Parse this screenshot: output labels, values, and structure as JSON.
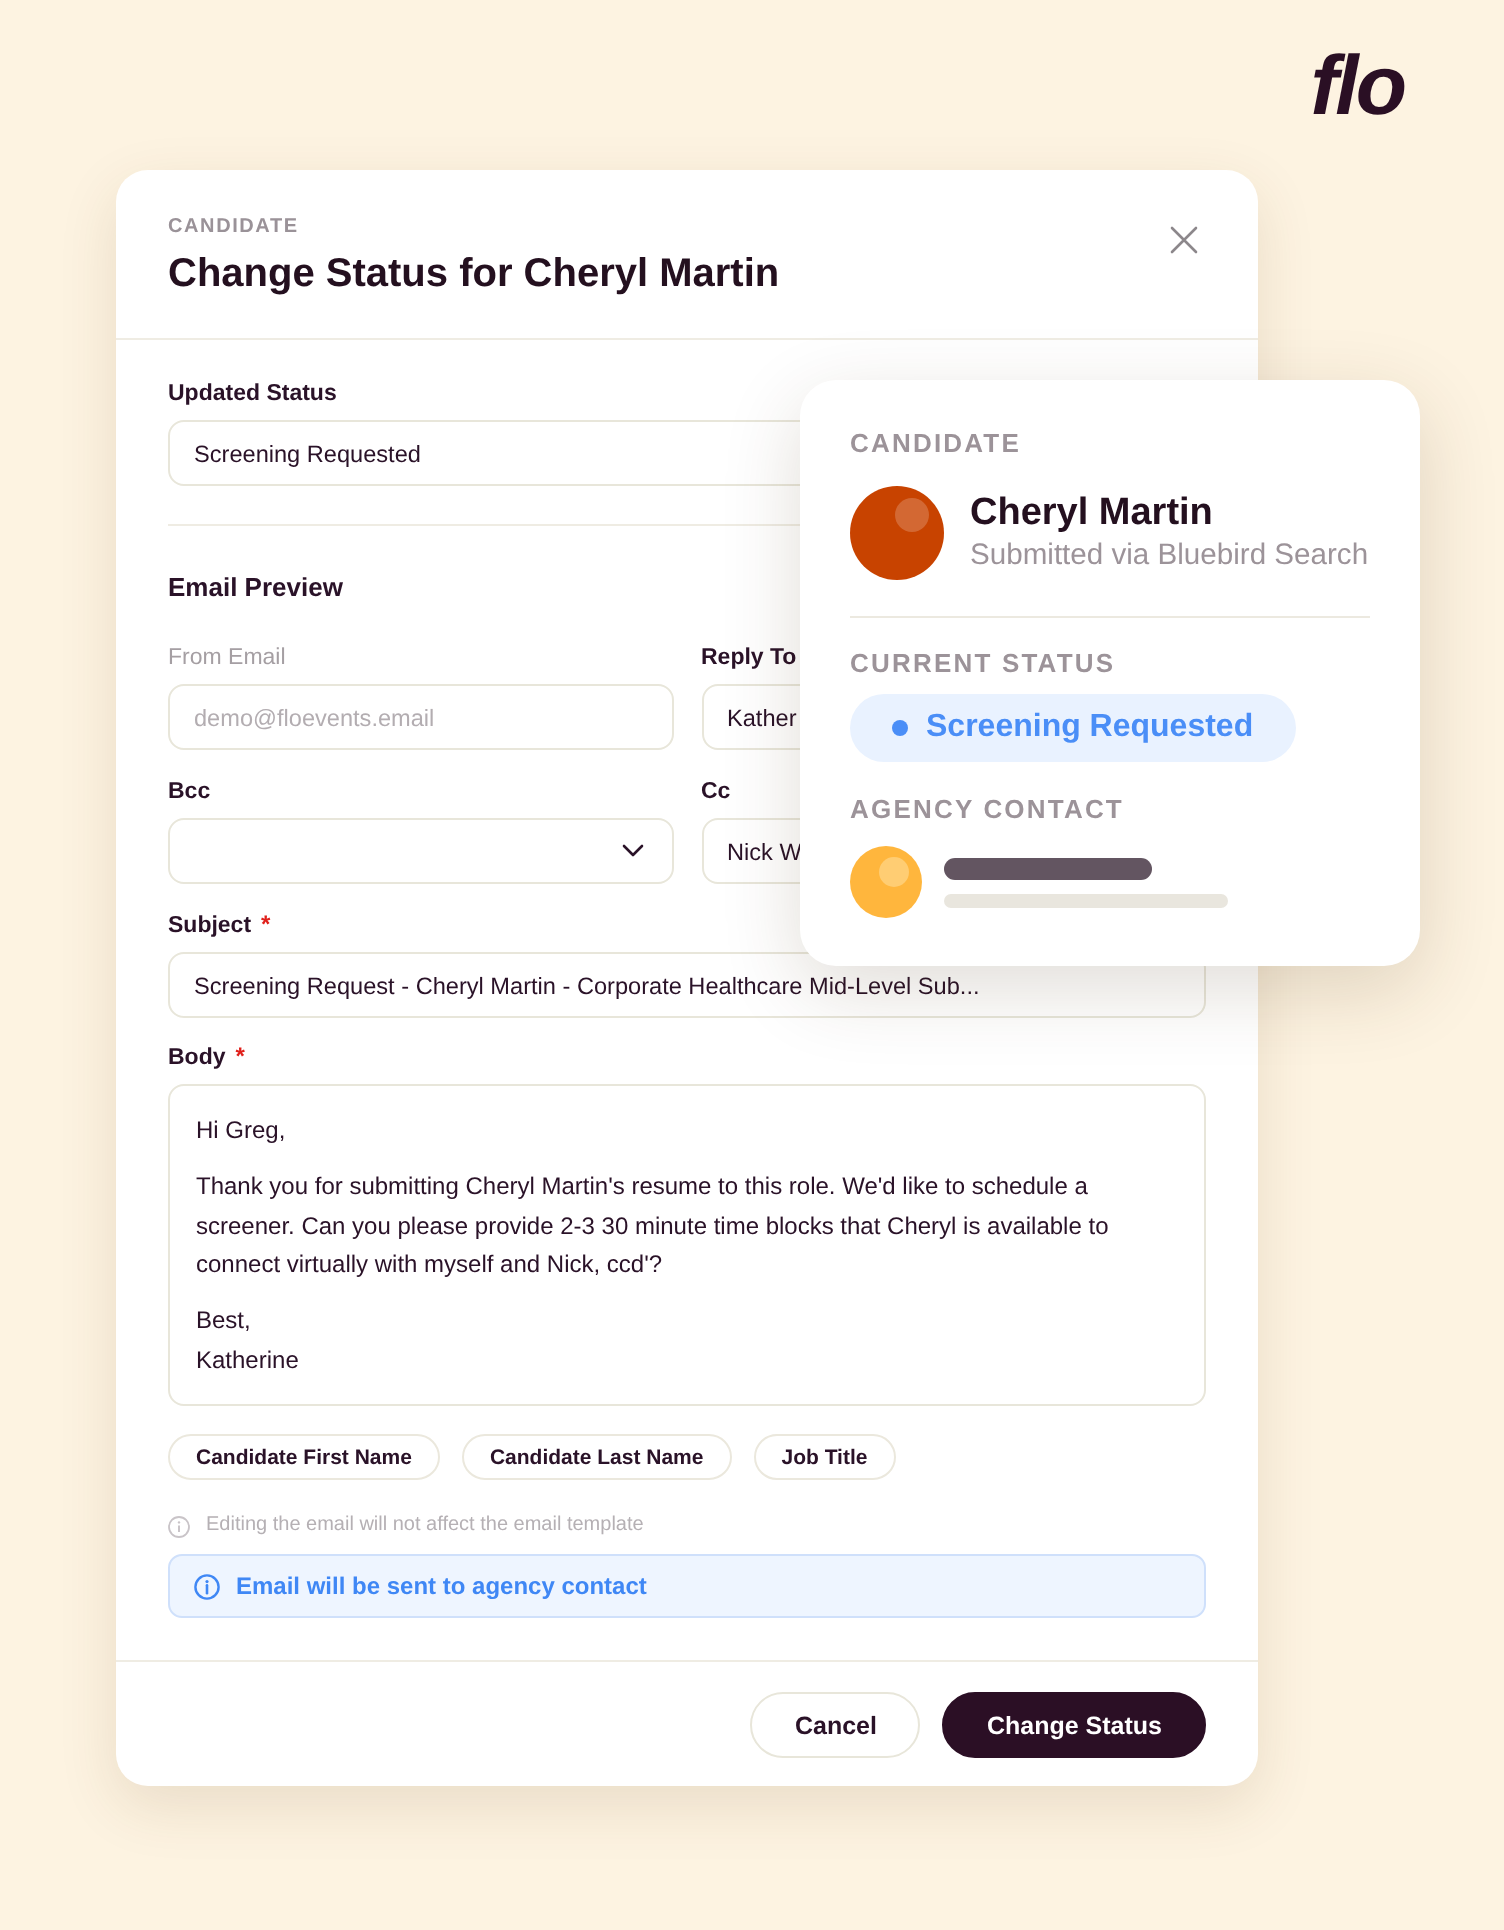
{
  "logo": {
    "text": "flo"
  },
  "modal": {
    "eyebrow": "CANDIDATE",
    "title": "Change Status for Cheryl Martin",
    "updated_status": {
      "label": "Updated Status",
      "value": "Screening Requested"
    },
    "email_preview": {
      "heading": "Email Preview",
      "fields": [
        {
          "kind": "text",
          "label": "From Email",
          "value": "demo@floevents.email",
          "disabled": true
        },
        {
          "kind": "text",
          "label": "Reply To",
          "value": "Kather",
          "disabled": false
        },
        {
          "kind": "select",
          "label": "Bcc",
          "disabled": false
        },
        {
          "kind": "text",
          "label": "Cc",
          "value": "Nick W",
          "disabled": false
        }
      ],
      "subject": {
        "label": "Subject",
        "required_mark": "*",
        "value": "Screening Request - Cheryl Martin - Corporate Healthcare Mid-Level Sub..."
      },
      "body": {
        "label": "Body",
        "required_mark": "*",
        "paragraphs": [
          "Hi Greg,",
          "Thank you for submitting Cheryl Martin's resume to this role. We'd like to schedule a screener. Can you please provide 2-3 30 minute time blocks that Cheryl is available to connect virtually with myself and Nick, ccd'?",
          "Best,\nKatherine"
        ]
      },
      "variable_chips": [
        "Candidate First Name",
        "Candidate Last Name",
        "Job Title"
      ],
      "hint": "Editing the email will not affect the email template",
      "notice": "Email will be sent to agency contact"
    },
    "buttons": [
      {
        "kind": "secondary",
        "label": "Cancel"
      },
      {
        "kind": "primary",
        "label": "Change Status"
      }
    ]
  },
  "candidate_card": {
    "section_label": "CANDIDATE",
    "name": "Cheryl Martin",
    "source": "Submitted via Bluebird Search",
    "status_label": "CURRENT STATUS",
    "status": "Screening Requested",
    "contact_label": "AGENCY CONTACT"
  }
}
